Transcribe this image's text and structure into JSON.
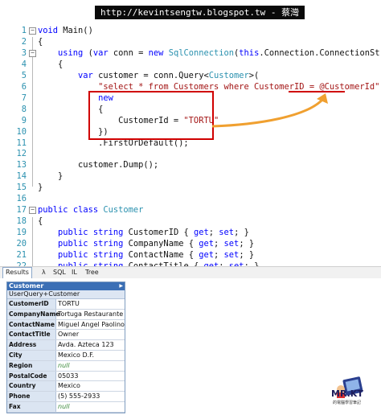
{
  "banner": {
    "text": "http://kevintsengtw.blogspot.tw - 蔡灣"
  },
  "code_lines": [
    {
      "n": "1",
      "code": "<span class=\"kw\">void</span> Main()"
    },
    {
      "n": "2",
      "code": "{"
    },
    {
      "n": "3",
      "code": "    <span class=\"kw\">using</span> (<span class=\"kw\">var</span> conn = <span class=\"kw\">new</span> <span class=\"ty\">SqlConnection</span>(<span class=\"kw\">this</span>.Connection.ConnectionString))"
    },
    {
      "n": "4",
      "code": "    {"
    },
    {
      "n": "5",
      "code": "        <span class=\"kw\">var</span> customer = conn.Query&lt;<span class=\"ty\">Customer</span>&gt;("
    },
    {
      "n": "6",
      "code": "            <span class=\"st\">\"select * from Customers where CustomerID = @CustomerId\"</span>,"
    },
    {
      "n": "7",
      "code": "            <span class=\"kw\">new</span>"
    },
    {
      "n": "8",
      "code": "            {"
    },
    {
      "n": "9",
      "code": "                CustomerId = <span class=\"st\">\"TORTU\"</span>"
    },
    {
      "n": "10",
      "code": "            })"
    },
    {
      "n": "11",
      "code": "            .FirstOrDefault();"
    },
    {
      "n": "12",
      "code": ""
    },
    {
      "n": "13",
      "code": "        customer.Dump();"
    },
    {
      "n": "14",
      "code": "    }"
    },
    {
      "n": "15",
      "code": "}"
    },
    {
      "n": "16",
      "code": ""
    },
    {
      "n": "17",
      "code": "<span class=\"kw\">public</span> <span class=\"kw\">class</span> <span class=\"ty\">Customer</span>"
    },
    {
      "n": "18",
      "code": "{"
    },
    {
      "n": "19",
      "code": "    <span class=\"kw\">public</span> <span class=\"kw\">string</span> CustomerID { <span class=\"kw\">get</span>; <span class=\"kw\">set</span>; }"
    },
    {
      "n": "20",
      "code": "    <span class=\"kw\">public</span> <span class=\"kw\">string</span> CompanyName { <span class=\"kw\">get</span>; <span class=\"kw\">set</span>; }"
    },
    {
      "n": "21",
      "code": "    <span class=\"kw\">public</span> <span class=\"kw\">string</span> ContactName { <span class=\"kw\">get</span>; <span class=\"kw\">set</span>; }"
    },
    {
      "n": "22",
      "code": "    <span class=\"kw\">public</span> <span class=\"kw\">string</span> ContactTitle { <span class=\"kw\">get</span>; <span class=\"kw\">set</span>; }"
    }
  ],
  "fold_lines": [
    "1",
    "3",
    "17"
  ],
  "tabs": {
    "results": "Results",
    "lambda": "λ",
    "sql": "SQL",
    "il": "IL",
    "tree": "Tree"
  },
  "result": {
    "title": "Customer",
    "subtitle": "UserQuery+Customer",
    "rows": [
      {
        "key": "CustomerID",
        "value": "TORTU",
        "is_null": false
      },
      {
        "key": "CompanyName",
        "value": "Tortuga Restaurante",
        "is_null": false
      },
      {
        "key": "ContactName",
        "value": "Miguel Angel Paolino",
        "is_null": false
      },
      {
        "key": "ContactTitle",
        "value": "Owner",
        "is_null": false
      },
      {
        "key": "Address",
        "value": "Avda. Azteca 123",
        "is_null": false
      },
      {
        "key": "City",
        "value": "Mexico D.F.",
        "is_null": false
      },
      {
        "key": "Region",
        "value": "null",
        "is_null": true
      },
      {
        "key": "PostalCode",
        "value": "05033",
        "is_null": false
      },
      {
        "key": "Country",
        "value": "Mexico",
        "is_null": false
      },
      {
        "key": "Phone",
        "value": "(5) 555-2933",
        "is_null": false
      },
      {
        "key": "Fax",
        "value": "null",
        "is_null": true
      }
    ]
  },
  "logo": {
    "text": "MR.KT",
    "subtitle": "的電腦學習筆記"
  },
  "colors": {
    "keyword": "#0000ff",
    "type": "#2b91af",
    "string": "#a31515",
    "highlight": "#d00000",
    "arrow": "#f0a030"
  }
}
